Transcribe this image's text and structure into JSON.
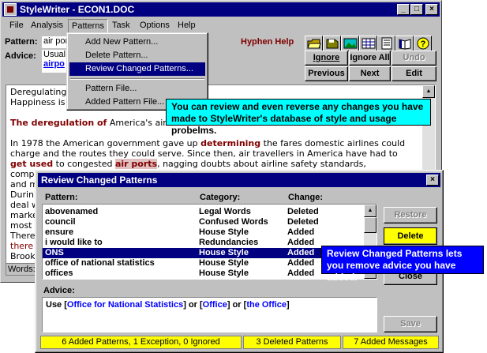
{
  "window": {
    "title": "StyleWriter - ECON1.DOC",
    "controls": [
      "_",
      "□",
      "×"
    ]
  },
  "menu": [
    "File",
    "Analysis",
    "Patterns",
    "Task",
    "Options",
    "Help"
  ],
  "pattern_row": {
    "label": "Pattern:",
    "value": "air por"
  },
  "advice_row": {
    "label": "Advice:",
    "value": "Usual",
    "link": "airpo"
  },
  "hyphen_help": "Hyphen Help",
  "toolbar": {
    "ignore": "Ignore",
    "ignore_all": "Ignore All",
    "undo": "Undo",
    "previous": "Previous",
    "next": "Next",
    "edit": "Edit"
  },
  "patterns_menu": {
    "items": [
      "Add New Pattern...",
      "Delete Pattern...",
      "Review Changed Patterns...",
      "Pattern File...",
      "Added Pattern File..."
    ],
    "selected_index": 2
  },
  "document": {
    "line1": "Deregulating",
    "line2": "Happiness is",
    "head_bold": "The deregulation of",
    "head_rest": " America's airlin",
    "p1": "In 1978 the American government gave up ",
    "p1_bold": "determining",
    "p1_end": " the fares domestic airlines could",
    "p2": "charge and the routes they could serve.  Since then, air travellers in America have had to",
    "p3_red": "get used",
    "p3_mid": " to congested ",
    "p3_hl": "air ports",
    "p3_end": ", nagging doubts about airline safety standards,",
    "p4": "compli",
    "p5": "and m",
    "p6": "Durin",
    "p7": "deal w",
    "p8": "marke",
    "p9": "most c",
    "p10": "There",
    "p11_red": "there",
    "p12": "Brook",
    "status": "Words:"
  },
  "tip1": "You can review and even reverse any changes you have made to StyleWriter's database of style and usage probelms.",
  "tip2": "Review Changed Patterns lets you remove advice you have added.",
  "dialog": {
    "title": "Review Changed Patterns",
    "close_icon": "×",
    "headers": {
      "pattern": "Pattern:",
      "category": "Category:",
      "change": "Change:"
    },
    "rows": [
      {
        "pattern": "abovenamed",
        "category": "Legal Words",
        "change": "Deleted"
      },
      {
        "pattern": "council",
        "category": "Confused Words",
        "change": "Deleted"
      },
      {
        "pattern": "ensure",
        "category": "House Style",
        "change": "Added"
      },
      {
        "pattern": "i would like to",
        "category": "Redundancies",
        "change": "Added"
      },
      {
        "pattern": "ONS",
        "category": "House Style",
        "change": "Added"
      },
      {
        "pattern": "office of national statistics",
        "category": "House Style",
        "change": "Added"
      },
      {
        "pattern": "offices",
        "category": "House Style",
        "change": "Added"
      }
    ],
    "selected_row": 4,
    "buttons": {
      "restore": "Restore",
      "delete": "Delete",
      "close": "Close",
      "save": "Save"
    },
    "advice_label": "Advice:",
    "advice": {
      "prefix": "Use [",
      "link1": "Office for National Statistics",
      "mid1": "] or [",
      "link2": "Office",
      "mid2": "] or [",
      "link3": "the Office",
      "suffix": "]"
    },
    "status": [
      "6 Added Patterns,    1 Exception,    0 Ignored",
      "3 Deleted Patterns",
      "7 Added Messages"
    ]
  }
}
